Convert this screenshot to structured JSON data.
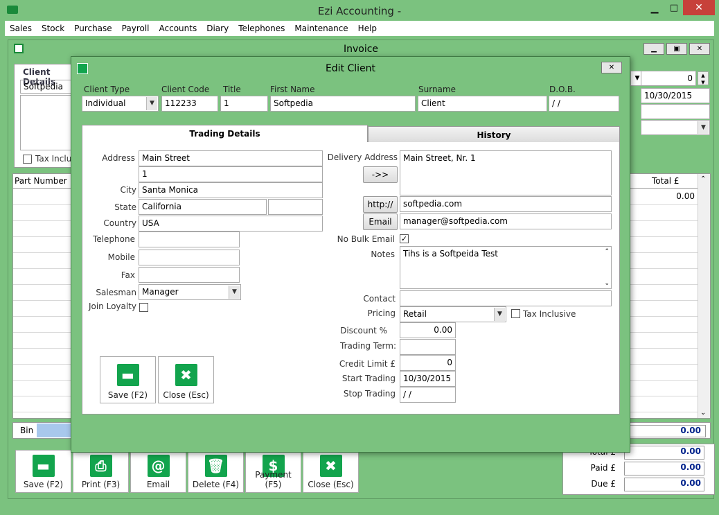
{
  "app": {
    "title": "Ezi Accounting -",
    "menu": [
      "Sales",
      "Stock",
      "Purchase",
      "Payroll",
      "Accounts",
      "Diary",
      "Telephones",
      "Maintenance",
      "Help"
    ]
  },
  "invoice": {
    "title": "Invoice",
    "client_details_label": "Client Details",
    "client_name": "Softpedia",
    "tax_inclusive_label": "Tax Inclus",
    "part_number_header": "Part Number",
    "total_header": "Total £",
    "total_value": "0.00",
    "spin_value": "0",
    "date_value": "10/30/2015",
    "bin_label": "Bin",
    "bin_total": "0.00",
    "totals": [
      {
        "label": "Total £",
        "value": "0.00"
      },
      {
        "label": "Paid £",
        "value": "0.00"
      },
      {
        "label": "Due £",
        "value": "0.00"
      }
    ],
    "buttons": [
      {
        "name": "save",
        "label": "Save (F2)",
        "icon": "▬"
      },
      {
        "name": "print",
        "label": "Print (F3)",
        "icon": "⎙"
      },
      {
        "name": "email",
        "label": "Email",
        "icon": "@"
      },
      {
        "name": "delete",
        "label": "Delete (F4)",
        "icon": "🗑"
      },
      {
        "name": "payment",
        "label": "Payment (F5)",
        "icon": "$"
      },
      {
        "name": "close",
        "label": "Close (Esc)",
        "icon": "✖"
      }
    ]
  },
  "dialog": {
    "title": "Edit Client",
    "header_labels": {
      "client_type": "Client Type",
      "client_code": "Client Code",
      "title": "Title",
      "first_name": "First Name",
      "surname": "Surname",
      "dob": "D.O.B."
    },
    "header_values": {
      "client_type": "Individual",
      "client_code": "112233",
      "title": "1",
      "first_name": "Softpedia",
      "surname": "Client",
      "dob": " / /"
    },
    "tabs": [
      "Trading Details",
      "History"
    ],
    "left": {
      "address_label": "Address",
      "address1": "Main Street",
      "address2": "1",
      "city_label": "City",
      "city": "Santa Monica",
      "state_label": "State",
      "state": "California",
      "country_label": "Country",
      "country": "USA",
      "telephone_label": "Telephone",
      "mobile_label": "Mobile",
      "fax_label": "Fax",
      "salesman_label": "Salesman",
      "salesman": "Manager",
      "join_loyalty_label": "Join Loyalty"
    },
    "right": {
      "delivery_label": "Delivery Address",
      "delivery_value": "Main Street, Nr. 1",
      "copy_button": "->>",
      "http_button": "http://",
      "website": "softpedia.com",
      "email_button": "Email",
      "email": "manager@softpedia.com",
      "no_bulk_label": "No Bulk Email",
      "notes_label": "Notes",
      "notes": "Tihs is a Softpeida Test",
      "contact_label": "Contact",
      "pricing_label": "Pricing",
      "pricing": "Retail",
      "tax_inclusive_label": "Tax Inclusive",
      "discount_label": "Discount %",
      "discount": "0.00",
      "trading_term_label": "Trading Term:",
      "credit_limit_label": "Credit Limit £",
      "credit_limit": "0",
      "start_trading_label": "Start Trading",
      "start_trading": "10/30/2015",
      "stop_trading_label": "Stop Trading",
      "stop_trading": " / /"
    },
    "buttons": {
      "save": "Save (F2)",
      "close": "Close (Esc)"
    }
  }
}
